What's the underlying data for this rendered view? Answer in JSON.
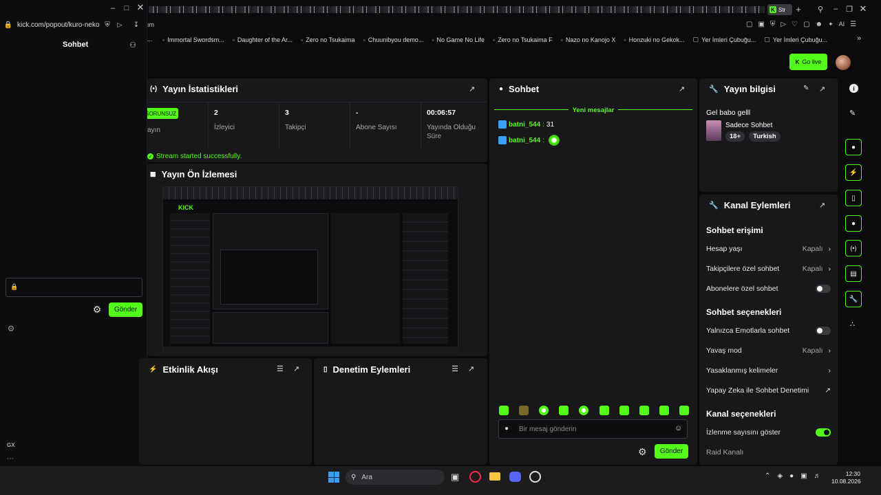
{
  "browser": {
    "address": "kick.com/popout/kuro-neko",
    "side_url_fragment": "ım",
    "active_tab_label": "Str",
    "bookmarks": [
      "Immortal Swordsm...",
      "Daughter of the Ar...",
      "Zero no Tsukaima",
      "Chuunibyou demo...",
      "No Game No Life",
      "Zero no Tsukaima F",
      "Nazo no Kanojo X",
      "Honzuki no Gekok...",
      "Yer İmleri Çubuğu...",
      "Yer İmleri Çubuğu..."
    ],
    "ai_label": "AI"
  },
  "popout_chat": {
    "title": "Sohbet",
    "send_label": "Gönder",
    "gx_label": "GX"
  },
  "header": {
    "go_live_label": "Go live"
  },
  "stats": {
    "title": "Yayın İstatistikleri",
    "status_badge": "SORUNSUZ",
    "status_caption": "ayın",
    "items": [
      {
        "value": "2",
        "label": "İzleyici"
      },
      {
        "value": "3",
        "label": "Takipçi"
      },
      {
        "value": "-",
        "label": "Abone Sayısı"
      },
      {
        "value": "00:06:57",
        "label": "Yayında Olduğu Süre"
      }
    ],
    "success_message": "Stream started successfully."
  },
  "preview": {
    "title": "Yayın Ön İzlemesi"
  },
  "activity": {
    "title": "Etkinlik Akışı"
  },
  "moderation": {
    "title": "Denetim Eylemleri"
  },
  "chat": {
    "title": "Sohbet",
    "new_messages": "Yeni mesajlar",
    "messages": [
      {
        "user": "batni_544",
        "text": "31"
      },
      {
        "user": "batni_544",
        "text": ""
      }
    ],
    "input_placeholder": "Bir mesaj gönderin",
    "send_label": "Gönder"
  },
  "stream_info": {
    "title": "Yayın bilgisi",
    "stream_title": "Gel babo gelll",
    "category": "Sadece Sohbet",
    "tags": [
      "18+",
      "Turkish"
    ]
  },
  "channel_actions": {
    "title": "Kanal Eylemleri",
    "chat_access": "Sohbet erişimi",
    "account_age": {
      "label": "Hesap yaşı",
      "value": "Kapalı"
    },
    "followers_only": {
      "label": "Takipçilere özel sohbet",
      "value": "Kapalı"
    },
    "subscribers_only": {
      "label": "Abonelere özel sohbet",
      "on": false
    },
    "chat_options": "Sohbet seçenekleri",
    "emotes_only": {
      "label": "Yalnızca Emotlarla sohbet",
      "on": false
    },
    "slow_mode": {
      "label": "Yavaş mod",
      "value": "Kapalı"
    },
    "banned_words": {
      "label": "Yasaklanmış kelimeler"
    },
    "ai_moderation": {
      "label": "Yapay Zeka ile Sohbet Denetimi"
    },
    "channel_options": "Kanal seçenekleri",
    "show_viewcount": {
      "label": "İzlenme sayısını göster",
      "on": true
    },
    "raid_channel": {
      "label": "Raid Kanalı"
    }
  },
  "taskbar": {
    "search_label": "Ara",
    "time": "12:30",
    "date": "10.08.2026"
  },
  "colors": {
    "accent": "#53fc18",
    "panel": "#18181b",
    "background": "#0b0b0d"
  }
}
